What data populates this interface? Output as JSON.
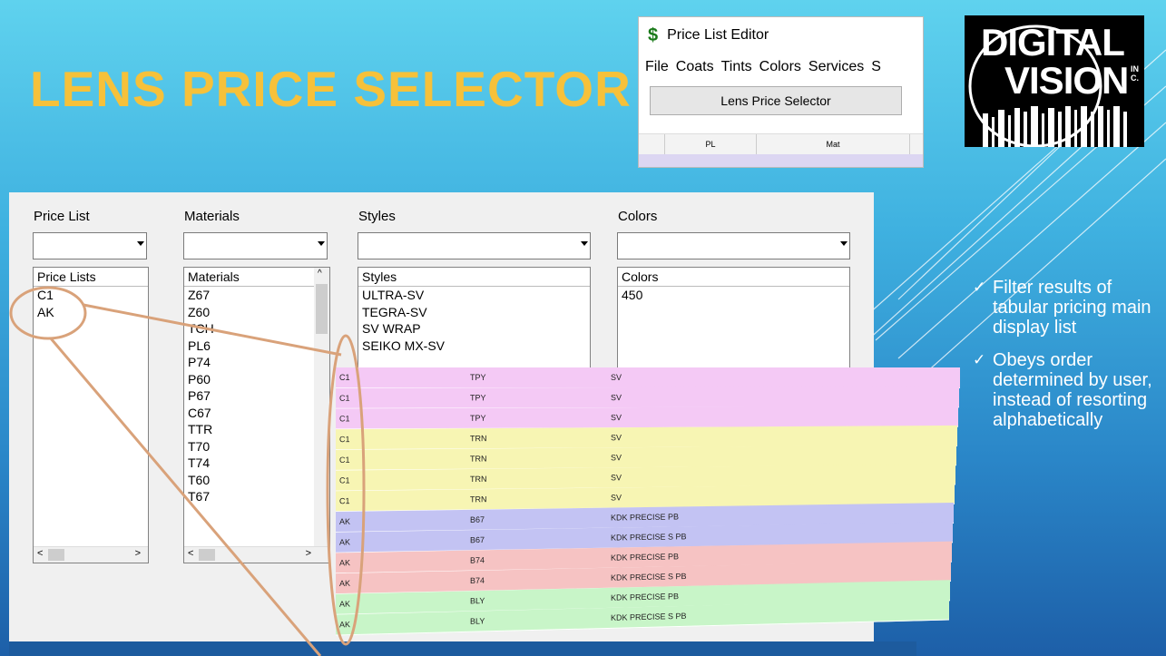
{
  "slide": {
    "title": "LENS PRICE SELECTOR",
    "title_color": "#f6c13a",
    "bullets": [
      {
        "icon": "check-icon",
        "text": "Filter results of tabular pricing main display list"
      },
      {
        "icon": "check-icon",
        "text": "Obeys order determined by user, instead of resorting alphabetically"
      }
    ]
  },
  "editor": {
    "app_icon": "dollar-icon",
    "icon_glyph": "$",
    "title": "Price List Editor",
    "menu": [
      "File",
      "Coats",
      "Tints",
      "Colors",
      "Services",
      "S"
    ],
    "button_label": "Lens Price Selector",
    "grid_headers": [
      "PL",
      "Mat"
    ]
  },
  "logo": {
    "line1": "DIGITAL",
    "line2": "VISION",
    "suffix": "INC."
  },
  "selector": {
    "filters": [
      {
        "label": "Price List",
        "value": ""
      },
      {
        "label": "Materials",
        "value": ""
      },
      {
        "label": "Styles",
        "value": ""
      },
      {
        "label": "Colors",
        "value": ""
      }
    ],
    "lists": [
      {
        "header": "Price Lists",
        "items": [
          "C1",
          "AK"
        ]
      },
      {
        "header": "Materials",
        "items": [
          "Z67",
          "Z60",
          "TCH",
          "PL6",
          "P74",
          "P60",
          "P67",
          "C67",
          "TTR",
          "T70",
          "T74",
          "T60",
          "T67"
        ]
      },
      {
        "header": "Styles",
        "items": [
          "ULTRA-SV",
          "TEGRA-SV",
          "SV WRAP",
          "SEIKO MX-SV"
        ]
      },
      {
        "header": "Colors",
        "items": [
          "450"
        ]
      }
    ]
  },
  "table": {
    "rows": [
      {
        "pl": "C1",
        "mat": "TPY",
        "style": "SV",
        "color": "#f4c9f5"
      },
      {
        "pl": "C1",
        "mat": "TPY",
        "style": "SV",
        "color": "#f4c9f5"
      },
      {
        "pl": "C1",
        "mat": "TPY",
        "style": "SV",
        "color": "#f4c9f5"
      },
      {
        "pl": "C1",
        "mat": "TRN",
        "style": "SV",
        "color": "#f7f5b3"
      },
      {
        "pl": "C1",
        "mat": "TRN",
        "style": "SV",
        "color": "#f7f5b3"
      },
      {
        "pl": "C1",
        "mat": "TRN",
        "style": "SV",
        "color": "#f7f5b3"
      },
      {
        "pl": "C1",
        "mat": "TRN",
        "style": "SV",
        "color": "#f7f5b3"
      },
      {
        "pl": "AK",
        "mat": "B67",
        "style": "KDK PRECISE PB",
        "color": "#c3c3f3"
      },
      {
        "pl": "AK",
        "mat": "B67",
        "style": "KDK PRECISE S PB",
        "color": "#c3c3f3"
      },
      {
        "pl": "AK",
        "mat": "B74",
        "style": "KDK PRECISE PB",
        "color": "#f6c3c3"
      },
      {
        "pl": "AK",
        "mat": "B74",
        "style": "KDK PRECISE S PB",
        "color": "#f6c3c3"
      },
      {
        "pl": "AK",
        "mat": "BLY",
        "style": "KDK PRECISE PB",
        "color": "#c8f5c8"
      },
      {
        "pl": "AK",
        "mat": "BLY",
        "style": "KDK PRECISE S PB",
        "color": "#c8f5c8"
      }
    ]
  }
}
